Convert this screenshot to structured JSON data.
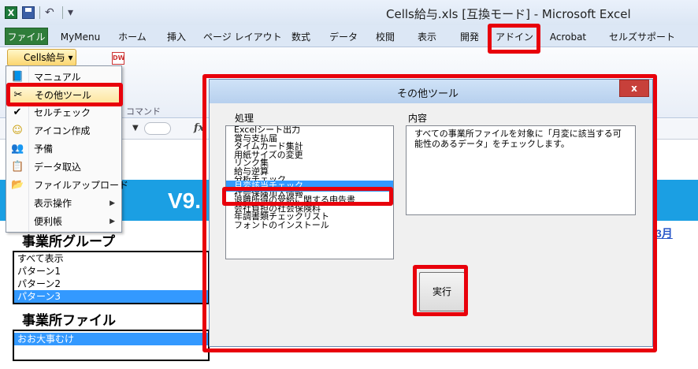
{
  "window": {
    "title": "Cells給与.xls  [互換モード] - Microsoft Excel"
  },
  "qat": {
    "excel_icon": "X",
    "undo_glyph": "↶",
    "customize_glyph": "▾"
  },
  "tabs": [
    "ファイル",
    "MyMenu",
    "ホーム",
    "挿入",
    "ページ レイアウト",
    "数式",
    "データ",
    "校閲",
    "表示",
    "開発",
    "アドイン",
    "Acrobat",
    "セルズサポート"
  ],
  "ribbon": {
    "cells_button": "Cells給与 ▾",
    "group_label": "コマンド",
    "dw_icon": "DW"
  },
  "formula_bar": {
    "fx_label": "fx",
    "namebox_arrow": "▼"
  },
  "menu": {
    "items": [
      {
        "label": "マニュアル",
        "icon": "manual-icon",
        "glyph": "📘",
        "submenu": false
      },
      {
        "label": "その他ツール",
        "icon": "tools-icon",
        "glyph": "✂",
        "submenu": false,
        "active": true
      },
      {
        "label": "セルチェック",
        "icon": "check-icon",
        "glyph": "✔",
        "submenu": false
      },
      {
        "label": "アイコン作成",
        "icon": "smiley-icon",
        "glyph": "☺",
        "submenu": false
      },
      {
        "label": "予備",
        "icon": "people-icon",
        "glyph": "👥",
        "submenu": false
      },
      {
        "label": "データ取込",
        "icon": "import-icon",
        "glyph": "📋",
        "submenu": false
      },
      {
        "label": "ファイルアップロード",
        "icon": "folder-icon",
        "glyph": "📂",
        "submenu": false
      },
      {
        "label": "表示操作",
        "icon": "",
        "glyph": "",
        "submenu": true
      },
      {
        "label": "便利帳",
        "icon": "",
        "glyph": "",
        "submenu": true
      }
    ],
    "submenu_arrow": "▶"
  },
  "sheet": {
    "banner": "V9.",
    "month_link": "3月",
    "group_title": "事業所グループ",
    "group_list": [
      {
        "label": "すべて表示",
        "selected": false
      },
      {
        "label": "パターン1",
        "selected": false
      },
      {
        "label": "パターン2",
        "selected": false
      },
      {
        "label": "パターン3",
        "selected": true
      }
    ],
    "file_title": "事業所ファイル",
    "file_list": [
      {
        "label": "おお大事むけ",
        "selected": true
      }
    ]
  },
  "dialog": {
    "title": "その他ツール",
    "close": "x",
    "proc_label": "処理",
    "content_label": "内容",
    "items": [
      {
        "label": "Excelシート出力",
        "selected": false
      },
      {
        "label": "賞与支払届",
        "selected": false
      },
      {
        "label": "タイムカード集計",
        "selected": false
      },
      {
        "label": "用紙サイズの変更",
        "selected": false
      },
      {
        "label": "リンク集",
        "selected": false
      },
      {
        "label": "給与逆算",
        "selected": false
      },
      {
        "label": "分析チェック",
        "selected": false
      },
      {
        "label": "月変該当チェック",
        "selected": true
      },
      {
        "label": "社会保険加入情報",
        "selected": false
      },
      {
        "label": "退職所得の受給に関する申告書",
        "selected": false
      },
      {
        "label": "会社負担の社会保険料",
        "selected": false
      },
      {
        "label": "年調書類チェックリスト",
        "selected": false
      },
      {
        "label": "フォントのインストール",
        "selected": false
      }
    ],
    "content_text": "すべての事業所ファイルを対象に「月変に該当する可能性のあるデータ」をチェックします。",
    "run_button": "実行"
  },
  "colors": {
    "highlight": "#e8000b",
    "accent_blue": "#1b9fe3",
    "selection": "#3399ff",
    "file_tab": "#2f7d3a"
  }
}
